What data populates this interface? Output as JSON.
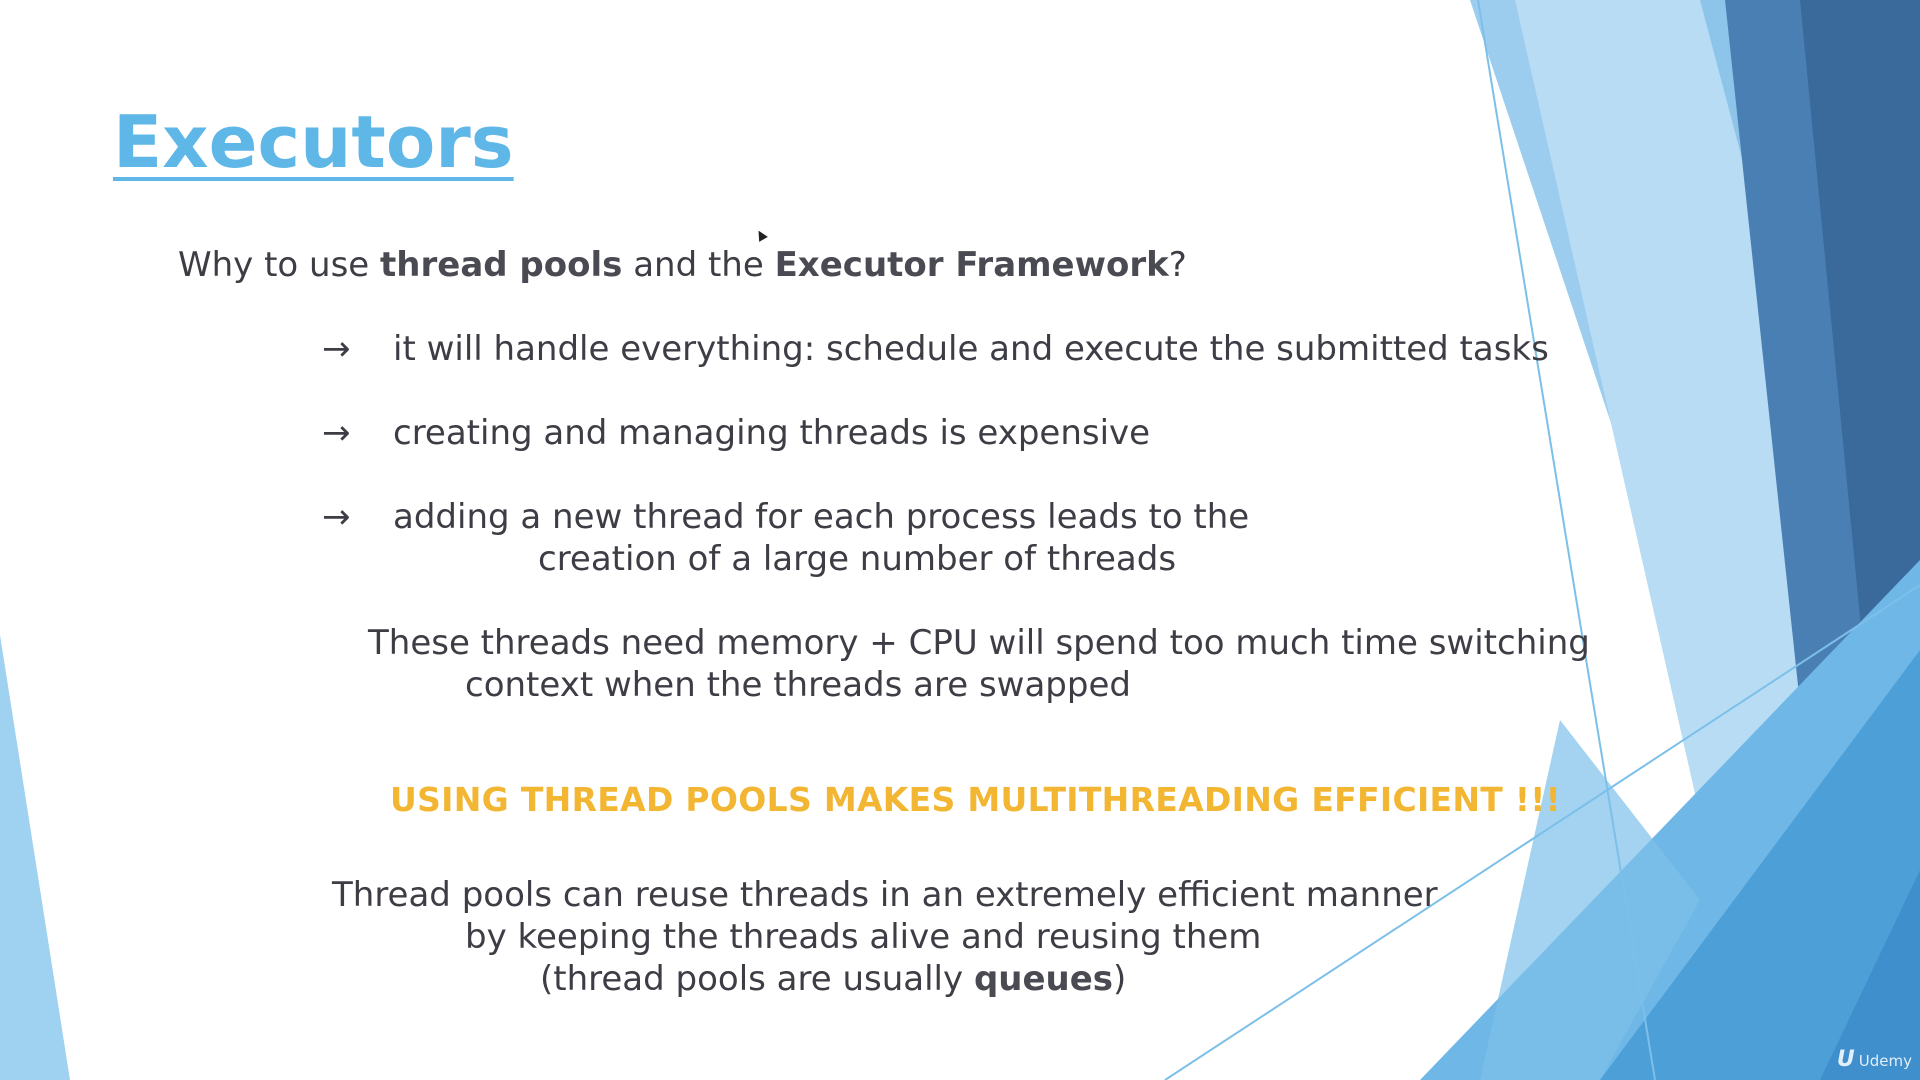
{
  "slide": {
    "title": "Executors",
    "question": {
      "prefix": "Why to use ",
      "term1": "thread pools",
      "mid": " and the ",
      "term2": "Executor Framework",
      "suffix": "?"
    },
    "bullets": [
      {
        "arrow": "→",
        "text": "it will handle everything: schedule and execute the submitted tasks"
      },
      {
        "arrow": "→",
        "text": "creating and managing threads is expensive"
      },
      {
        "arrow": "→",
        "text": "adding a new thread for each process leads to the",
        "continuation": "creation of a large number of threads"
      }
    ],
    "note": {
      "line1": "These threads need memory + CPU will spend too much time switching",
      "line2": "context when the threads are swapped"
    },
    "callout": "USING THREAD POOLS MAKES MULTITHREADING EFFICIENT !!!",
    "summary": {
      "line1": "Thread pools can reuse threads in an extremely efficient manner",
      "line2": "by keeping the threads alive and reusing them",
      "line3_prefix": "(thread pools are usually ",
      "line3_bold": "queues",
      "line3_suffix": ")"
    },
    "watermark": {
      "mark": "U",
      "text": "Udemy"
    }
  },
  "colors": {
    "title": "#5eb7e6",
    "body_text": "#3d3d45",
    "callout": "#f2b632",
    "accent_light": "#a6d4f2",
    "accent_mid": "#5aa9dd",
    "accent_dark": "#3a6a9c"
  }
}
